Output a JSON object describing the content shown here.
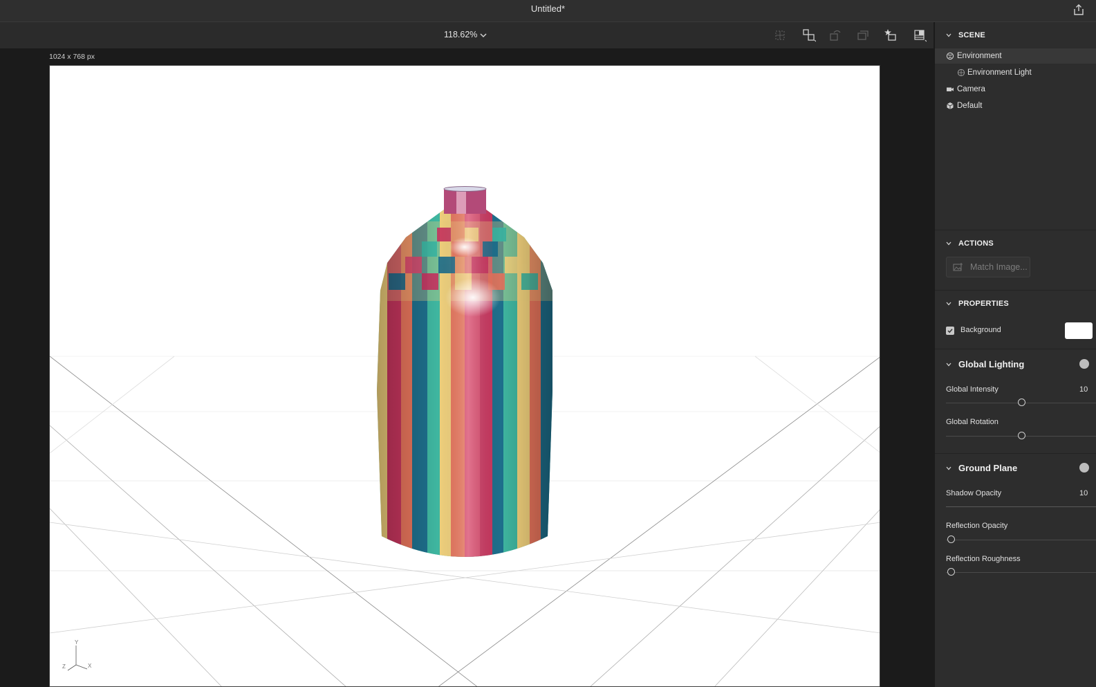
{
  "window": {
    "title": "Untitled*"
  },
  "toolbar": {
    "zoom": "118.62%",
    "tools": [
      "frame-select-icon",
      "select-move-icon",
      "orbit-icon",
      "pan-icon",
      "light-place-icon",
      "render-preview-icon"
    ]
  },
  "canvas": {
    "size_label": "1024 x 768 px",
    "axes": {
      "y": "Y",
      "z": "Z",
      "x": "X"
    }
  },
  "scene": {
    "header": "SCENE",
    "items": [
      {
        "label": "Environment",
        "icon": "globe-icon"
      },
      {
        "label": "Environment Light",
        "icon": "light-globe-icon"
      },
      {
        "label": "Camera",
        "icon": "camera-icon"
      },
      {
        "label": "Default",
        "icon": "cube-icon"
      }
    ]
  },
  "actions": {
    "header": "ACTIONS",
    "match_image": "Match Image..."
  },
  "properties": {
    "header": "PROPERTIES",
    "background_label": "Background",
    "background_checked": true,
    "background_color": "#ffffff",
    "global_lighting": {
      "header": "Global Lighting",
      "intensity_label": "Global Intensity",
      "intensity_value": "10",
      "rotation_label": "Global Rotation"
    },
    "ground_plane": {
      "header": "Ground Plane",
      "shadow_label": "Shadow Opacity",
      "shadow_value": "10",
      "reflection_opacity_label": "Reflection Opacity",
      "reflection_roughness_label": "Reflection Roughness"
    }
  },
  "colors": {
    "accent_bg": "#2d2d2d",
    "bottle_stripes": [
      "#c9365f",
      "#1e6f8c",
      "#3fb6a0",
      "#f2d27d",
      "#e8755c",
      "#d94c6e"
    ]
  }
}
